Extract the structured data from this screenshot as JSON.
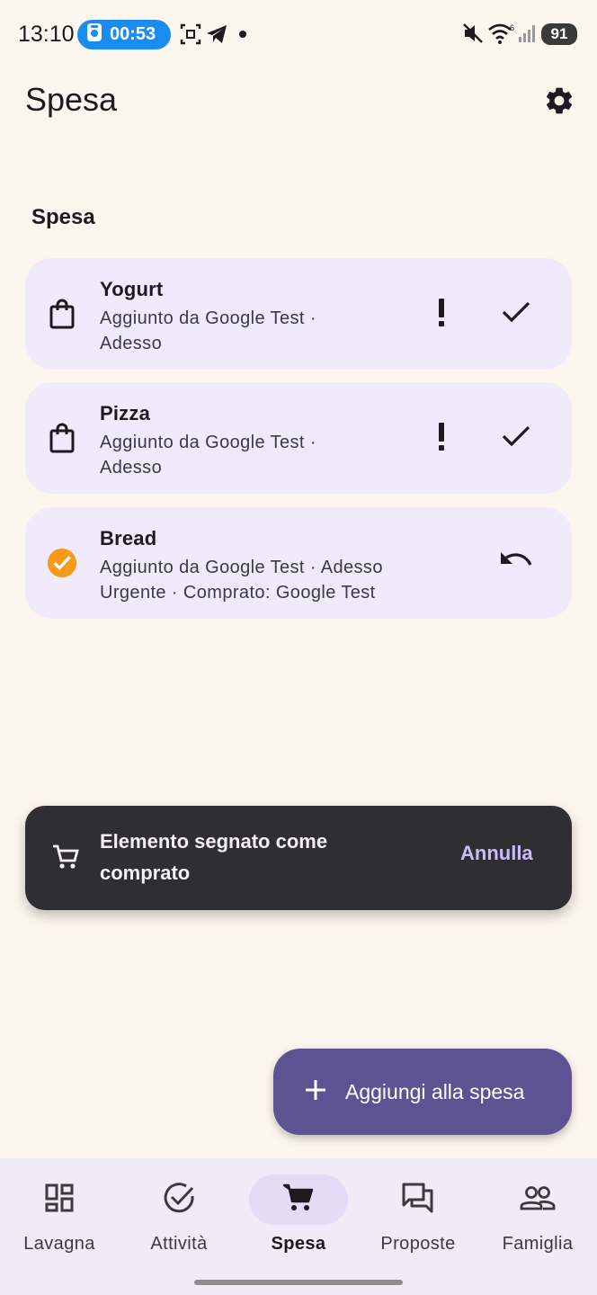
{
  "status_bar": {
    "time": "13:10",
    "recording_timer": "00:53",
    "battery": "91"
  },
  "app_bar": {
    "title": "Spesa"
  },
  "section": {
    "title": "Spesa"
  },
  "items": [
    {
      "name": "Yogurt",
      "subtitle_line1": "Aggiunto da Google Test ·",
      "subtitle_line2": "Adesso",
      "status": "pending"
    },
    {
      "name": "Pizza",
      "subtitle_line1": "Aggiunto da Google Test ·",
      "subtitle_line2": "Adesso",
      "status": "pending"
    },
    {
      "name": "Bread",
      "subtitle_line1": "Aggiunto da Google Test · Adesso",
      "subtitle_line2": "Urgente · Comprato: Google Test",
      "status": "bought"
    }
  ],
  "snackbar": {
    "message": "Elemento segnato come comprato",
    "action": "Annulla"
  },
  "fab": {
    "label": "Aggiungi alla spesa"
  },
  "bottom_nav": {
    "items": [
      {
        "label": "Lavagna",
        "icon": "dashboard-icon"
      },
      {
        "label": "Attività",
        "icon": "check-circle-icon"
      },
      {
        "label": "Spesa",
        "icon": "cart-icon",
        "active": true
      },
      {
        "label": "Proposte",
        "icon": "forum-icon"
      },
      {
        "label": "Famiglia",
        "icon": "group-icon"
      }
    ]
  },
  "colors": {
    "background": "#fdf6ee",
    "card": "#f0ebfa",
    "fab": "#5d5393",
    "snackbar": "#2f2e33",
    "snackbar_action": "#cbbef7",
    "bought_check": "#f59a1b",
    "nav_active_pill": "#e3dcf6"
  }
}
